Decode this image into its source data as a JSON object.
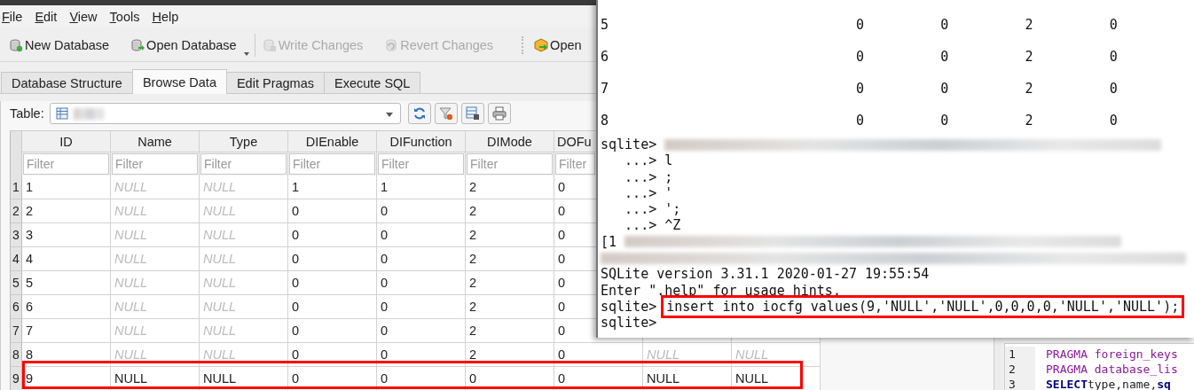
{
  "menu": [
    "File",
    "Edit",
    "View",
    "Tools",
    "Help"
  ],
  "toolbar": [
    {
      "label": "New Database",
      "disabled": false,
      "dropdown": false
    },
    {
      "label": "Open Database",
      "disabled": false,
      "dropdown": true
    },
    {
      "label": "Write Changes",
      "disabled": true,
      "dropdown": false
    },
    {
      "label": "Revert Changes",
      "disabled": true,
      "dropdown": false
    },
    {
      "label": "Open",
      "disabled": false,
      "dropdown": false
    }
  ],
  "tabs": [
    {
      "label": "Database Structure",
      "selected": false
    },
    {
      "label": "Browse Data",
      "selected": true
    },
    {
      "label": "Edit Pragmas",
      "selected": false
    },
    {
      "label": "Execute SQL",
      "selected": false
    }
  ],
  "table_selector": {
    "label": "Table:"
  },
  "grid": {
    "columns": [
      {
        "header": "ID",
        "placeholder": "Filter"
      },
      {
        "header": "Name",
        "placeholder": "Filter"
      },
      {
        "header": "Type",
        "placeholder": "Filter"
      },
      {
        "header": "DIEnable",
        "placeholder": "Filter"
      },
      {
        "header": "DIFunction",
        "placeholder": "Filter"
      },
      {
        "header": "DIMode",
        "placeholder": "Filter"
      },
      {
        "header": "DOFu",
        "placeholder": "Filter"
      }
    ],
    "rows": [
      {
        "number": "1",
        "highlighted": false,
        "cells": [
          {
            "text": "1",
            "is_null": false
          },
          {
            "text": "NULL",
            "is_null": true
          },
          {
            "text": "NULL",
            "is_null": true
          },
          {
            "text": "1",
            "is_null": false
          },
          {
            "text": "1",
            "is_null": false
          },
          {
            "text": "2",
            "is_null": false
          },
          {
            "text": "0",
            "is_null": false
          }
        ]
      },
      {
        "number": "2",
        "highlighted": false,
        "cells": [
          {
            "text": "2",
            "is_null": false
          },
          {
            "text": "NULL",
            "is_null": true
          },
          {
            "text": "NULL",
            "is_null": true
          },
          {
            "text": "0",
            "is_null": false
          },
          {
            "text": "0",
            "is_null": false
          },
          {
            "text": "2",
            "is_null": false
          },
          {
            "text": "0",
            "is_null": false
          }
        ]
      },
      {
        "number": "3",
        "highlighted": false,
        "cells": [
          {
            "text": "3",
            "is_null": false
          },
          {
            "text": "NULL",
            "is_null": true
          },
          {
            "text": "NULL",
            "is_null": true
          },
          {
            "text": "0",
            "is_null": false
          },
          {
            "text": "0",
            "is_null": false
          },
          {
            "text": "2",
            "is_null": false
          },
          {
            "text": "0",
            "is_null": false
          }
        ]
      },
      {
        "number": "4",
        "highlighted": false,
        "cells": [
          {
            "text": "4",
            "is_null": false
          },
          {
            "text": "NULL",
            "is_null": true
          },
          {
            "text": "NULL",
            "is_null": true
          },
          {
            "text": "0",
            "is_null": false
          },
          {
            "text": "0",
            "is_null": false
          },
          {
            "text": "2",
            "is_null": false
          },
          {
            "text": "0",
            "is_null": false
          }
        ]
      },
      {
        "number": "5",
        "highlighted": false,
        "cells": [
          {
            "text": "5",
            "is_null": false
          },
          {
            "text": "NULL",
            "is_null": true
          },
          {
            "text": "NULL",
            "is_null": true
          },
          {
            "text": "0",
            "is_null": false
          },
          {
            "text": "0",
            "is_null": false
          },
          {
            "text": "2",
            "is_null": false
          },
          {
            "text": "0",
            "is_null": false
          }
        ]
      },
      {
        "number": "6",
        "highlighted": false,
        "cells": [
          {
            "text": "6",
            "is_null": false
          },
          {
            "text": "NULL",
            "is_null": true
          },
          {
            "text": "NULL",
            "is_null": true
          },
          {
            "text": "0",
            "is_null": false
          },
          {
            "text": "0",
            "is_null": false
          },
          {
            "text": "2",
            "is_null": false
          },
          {
            "text": "0",
            "is_null": false
          }
        ]
      },
      {
        "number": "7",
        "highlighted": false,
        "cells": [
          {
            "text": "7",
            "is_null": false
          },
          {
            "text": "NULL",
            "is_null": true
          },
          {
            "text": "NULL",
            "is_null": true
          },
          {
            "text": "0",
            "is_null": false
          },
          {
            "text": "0",
            "is_null": false
          },
          {
            "text": "2",
            "is_null": false
          },
          {
            "text": "0",
            "is_null": false
          }
        ]
      },
      {
        "number": "8",
        "highlighted": false,
        "cells": [
          {
            "text": "8",
            "is_null": false
          },
          {
            "text": "NULL",
            "is_null": true
          },
          {
            "text": "NULL",
            "is_null": true
          },
          {
            "text": "0",
            "is_null": false
          },
          {
            "text": "0",
            "is_null": false
          },
          {
            "text": "2",
            "is_null": false
          },
          {
            "text": "0",
            "is_null": false
          },
          {
            "text": "NULL",
            "is_null": true
          },
          {
            "text": "NULL",
            "is_null": true
          }
        ]
      },
      {
        "number": "9",
        "highlighted": true,
        "cells": [
          {
            "text": "9",
            "is_null": false
          },
          {
            "text": "NULL",
            "is_null": false
          },
          {
            "text": "NULL",
            "is_null": false
          },
          {
            "text": "0",
            "is_null": false
          },
          {
            "text": "0",
            "is_null": false
          },
          {
            "text": "0",
            "is_null": false
          },
          {
            "text": "0",
            "is_null": false
          },
          {
            "text": "NULL",
            "is_null": false
          },
          {
            "text": "NULL",
            "is_null": false
          }
        ]
      }
    ]
  },
  "sql_log": [
    {
      "number": "1",
      "tokens": [
        {
          "text": "PRAGMA foreign_keys",
          "kind": "pragma"
        }
      ]
    },
    {
      "number": "2",
      "tokens": [
        {
          "text": "PRAGMA database_lis",
          "kind": "pragma"
        }
      ]
    },
    {
      "number": "3",
      "tokens": [
        {
          "text": "SELECT",
          "kind": "keyword"
        },
        {
          "text": "type,name,",
          "kind": "plain"
        },
        {
          "text": "sq",
          "kind": "keyword"
        }
      ]
    }
  ],
  "terminal": {
    "output_rows": [
      [
        "5",
        "0",
        "0",
        "2",
        "0"
      ],
      [
        "6",
        "0",
        "0",
        "2",
        "0"
      ],
      [
        "7",
        "0",
        "0",
        "2",
        "0"
      ],
      [
        "8",
        "0",
        "0",
        "2",
        "0"
      ]
    ],
    "lines": [
      {
        "kind": "prompt",
        "prompt": "sqlite>",
        "redacted_tail": true
      },
      {
        "kind": "continuation",
        "prompt": "...>",
        "input": "l"
      },
      {
        "kind": "continuation",
        "prompt": "...>",
        "input": ";"
      },
      {
        "kind": "continuation",
        "prompt": "...>",
        "input": "'"
      },
      {
        "kind": "continuation",
        "prompt": "...>",
        "input": "';"
      },
      {
        "kind": "continuation",
        "prompt": "...>",
        "input": "^Z"
      },
      {
        "kind": "output",
        "text": "[1",
        "redacted_tail": true
      },
      {
        "kind": "redacted"
      },
      {
        "kind": "output",
        "text": "SQLite version 3.31.1 2020-01-27 19:55:54"
      },
      {
        "kind": "output",
        "text": "Enter \".help\" for usage hints."
      },
      {
        "kind": "prompt",
        "prompt": "sqlite>",
        "input": "insert into iocfg values(9,'NULL','NULL',0,0,0,0,'NULL','NULL');",
        "highlighted": true
      },
      {
        "kind": "prompt",
        "prompt": "sqlite>"
      }
    ]
  }
}
